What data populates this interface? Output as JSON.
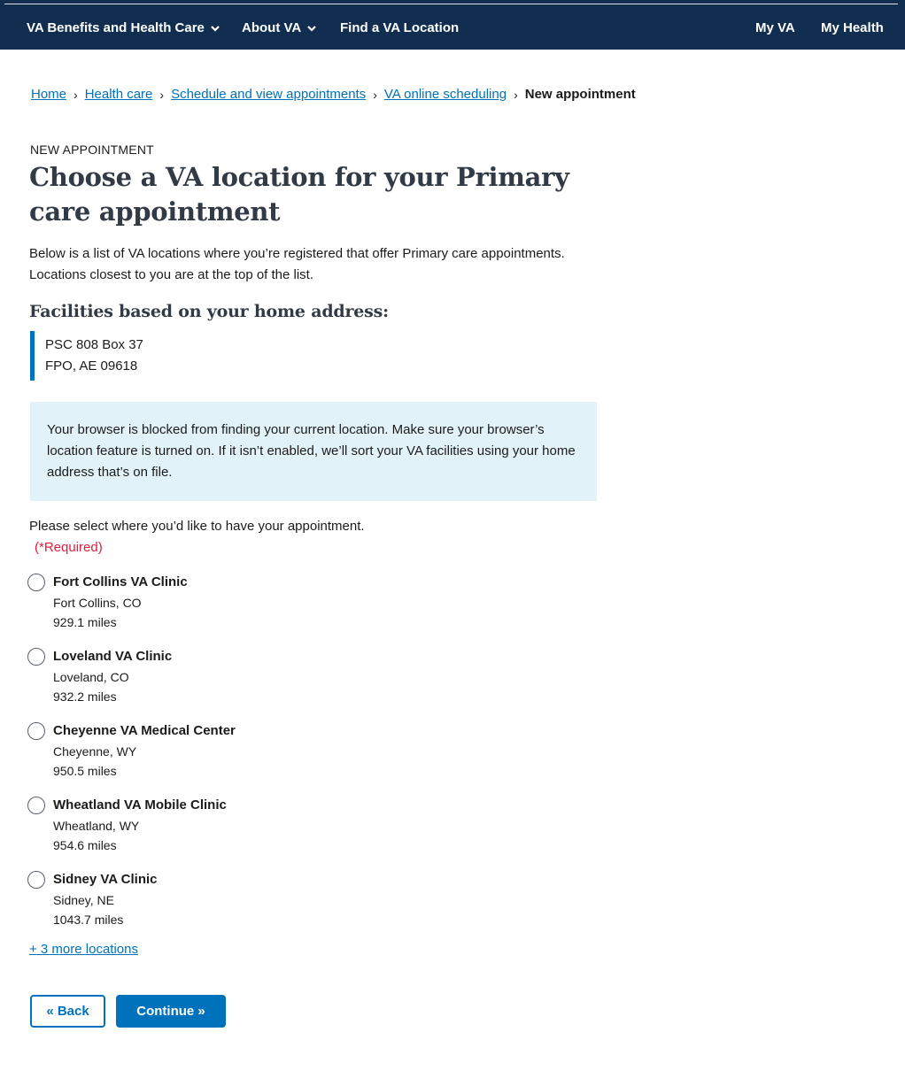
{
  "nav": {
    "items": [
      {
        "label": "VA Benefits and Health Care"
      },
      {
        "label": "About VA"
      },
      {
        "label": "Find a VA Location"
      }
    ],
    "right_items": [
      {
        "label": "My VA"
      },
      {
        "label": "My Health"
      }
    ]
  },
  "breadcrumb": {
    "items": [
      "Home",
      "Health care",
      "Schedule and view appointments",
      "VA online scheduling"
    ],
    "current": "New appointment",
    "separator": "›"
  },
  "page": {
    "eyebrow": "NEW APPOINTMENT",
    "title": "Choose a VA location for your Primary care appointment",
    "intro": "Below is a list of VA locations where you’re registered that offer Primary care appointments. Locations closest to you are at the top of the list.",
    "section_heading": "Facilities based on your home address:",
    "address_line1": "PSC 808 Box 37",
    "address_line2": "FPO, AE 09618",
    "alert_text": "Your browser is blocked from finding your current location. Make sure your browser’s location feature is turned on. If it isn’t enabled, we’ll sort your VA facilities using your home address that’s on file.",
    "prompt": "Please select where you’d like to have your appointment.",
    "required": "(*Required)"
  },
  "facilities": [
    {
      "name": "Fort Collins VA Clinic",
      "location": "Fort Collins, CO",
      "distance": "929.1 miles"
    },
    {
      "name": "Loveland VA Clinic",
      "location": "Loveland, CO",
      "distance": "932.2 miles"
    },
    {
      "name": "Cheyenne VA Medical Center",
      "location": "Cheyenne, WY",
      "distance": "950.5 miles"
    },
    {
      "name": "Wheatland VA Mobile Clinic",
      "location": "Wheatland, WY",
      "distance": "954.6 miles"
    },
    {
      "name": "Sidney VA Clinic",
      "location": "Sidney, NE",
      "distance": "1043.7 miles"
    }
  ],
  "more_locations": "+ 3 more locations",
  "buttons": {
    "back": "« Back",
    "continue": "Continue »"
  },
  "colors": {
    "nav_bg": "#112e51",
    "link": "#0071bb",
    "alert_bg": "#e1f3f8",
    "required": "#e31c3d"
  },
  "icons": {
    "nav_dropdown": "chevron-down-icon"
  }
}
